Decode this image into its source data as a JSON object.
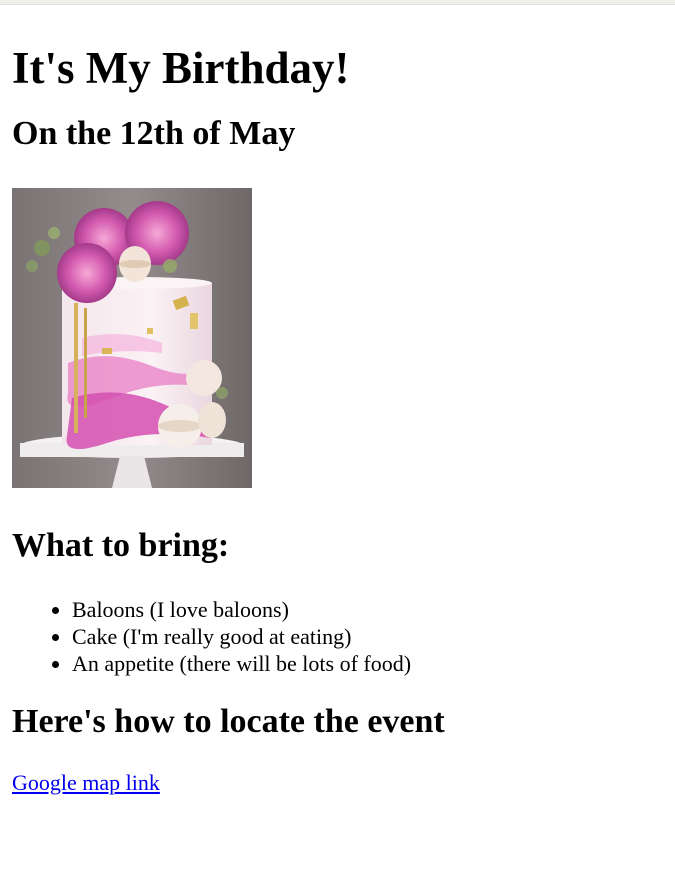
{
  "header": {
    "title": "It's My Birthday!",
    "date_heading": "On the 12th of May"
  },
  "image": {
    "alt": "Pink birthday cake with flowers and macarons"
  },
  "bring": {
    "heading": "What to bring:",
    "items": [
      "Baloons (I love baloons)",
      "Cake (I'm really good at eating)",
      "An appetite (there will be lots of food)"
    ]
  },
  "location": {
    "heading": "Here's how to locate the event",
    "link_text": "Google map link"
  },
  "colors": {
    "link": "#0000ee",
    "cake_pink": "#d34fb0",
    "background_grey": "#8c8585"
  }
}
